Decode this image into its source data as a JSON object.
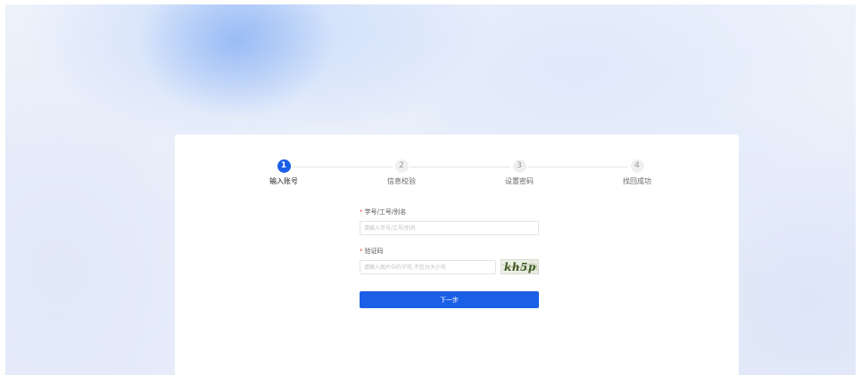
{
  "steps": [
    {
      "num": "1",
      "label": "输入账号",
      "active": true
    },
    {
      "num": "2",
      "label": "信息校验",
      "active": false
    },
    {
      "num": "3",
      "label": "设置密码",
      "active": false
    },
    {
      "num": "4",
      "label": "找回成功",
      "active": false
    }
  ],
  "form": {
    "account": {
      "required_mark": "*",
      "label": "学号/工号/别名",
      "placeholder": "请输入学号/工号/别名",
      "value": ""
    },
    "captcha": {
      "required_mark": "*",
      "label": "验证码",
      "placeholder": "请输入图片中的字符,不区分大小写",
      "value": "",
      "image_text": "kh5p"
    },
    "next_label": "下一步"
  },
  "colors": {
    "primary": "#1b5fe6",
    "required": "#f04b4b"
  }
}
